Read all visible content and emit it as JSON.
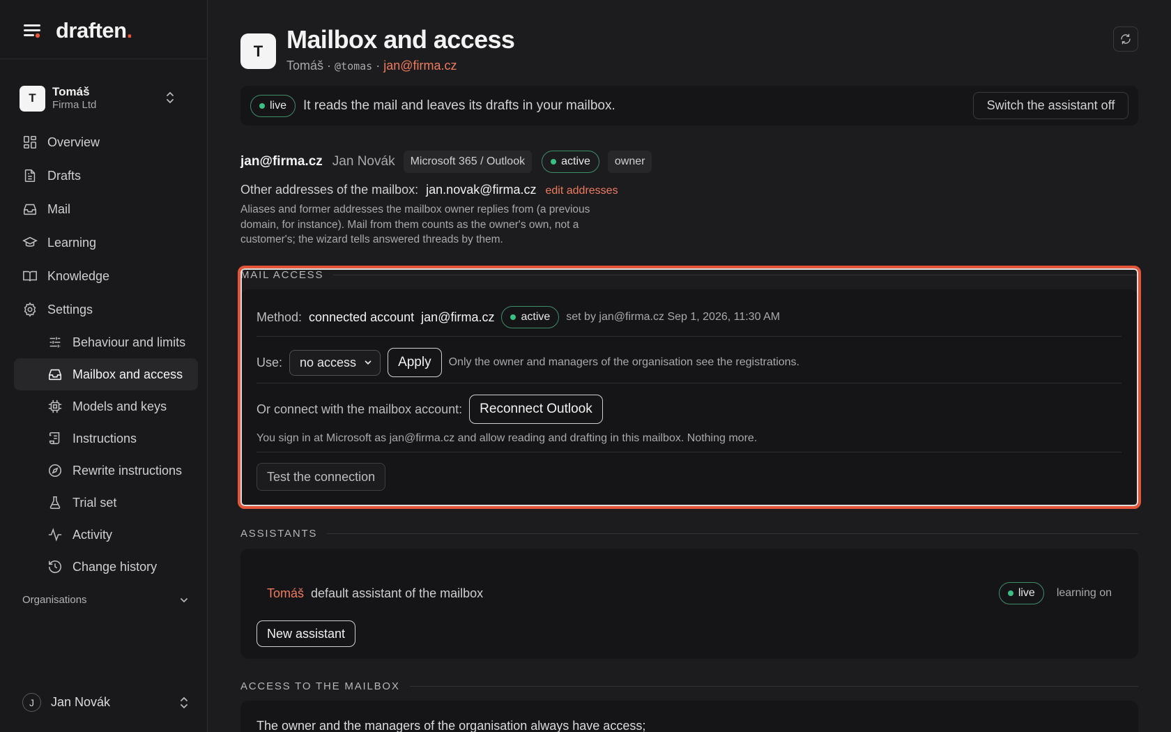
{
  "brand": {
    "logo_text": "draften",
    "logo_dot": "."
  },
  "org": {
    "avatar": "T",
    "name": "Tomáš",
    "company": "Firma Ltd"
  },
  "nav": [
    {
      "label": "Overview",
      "icon": "grid-icon"
    },
    {
      "label": "Drafts",
      "icon": "document-icon"
    },
    {
      "label": "Mail",
      "icon": "inbox-icon"
    },
    {
      "label": "Learning",
      "icon": "graduation-cap-icon"
    },
    {
      "label": "Knowledge",
      "icon": "book-icon"
    },
    {
      "label": "Settings",
      "icon": "gear-icon"
    }
  ],
  "settings_sub": [
    {
      "label": "Behaviour and limits",
      "icon": "sliders-icon"
    },
    {
      "label": "Mailbox and access",
      "icon": "inbox-icon",
      "active": true
    },
    {
      "label": "Models and keys",
      "icon": "cpu-icon"
    },
    {
      "label": "Instructions",
      "icon": "scroll-icon"
    },
    {
      "label": "Rewrite instructions",
      "icon": "compass-icon"
    },
    {
      "label": "Trial set",
      "icon": "flask-icon"
    },
    {
      "label": "Activity",
      "icon": "activity-icon"
    },
    {
      "label": "Change history",
      "icon": "history-icon"
    }
  ],
  "organisations_label": "Organisations",
  "user": {
    "avatar": "J",
    "name": "Jan Novák"
  },
  "header": {
    "avatar": "T",
    "title": "Mailbox and access",
    "sub_name": "Tomáš",
    "sub_sep": " · ",
    "sub_handle": "@tomas",
    "sub_email": "jan@firma.cz"
  },
  "status": {
    "badge": "live",
    "text": "It reads the mail and leaves its drafts in your mailbox.",
    "switch_off": "Switch the assistant off"
  },
  "mailbox": {
    "email": "jan@firma.cz",
    "owner_name": "Jan Novák",
    "provider": "Microsoft 365 / Outlook",
    "state": "active",
    "role": "owner",
    "aliases_label": "Other addresses of the mailbox:",
    "aliases_value": "jan.novak@firma.cz",
    "edit_link": "edit addresses",
    "help": "Aliases and former addresses the mailbox owner replies from (a previous domain, for instance). Mail from them counts as the owner's own, not a customer's; the wizard tells answered threads by them."
  },
  "mail_access": {
    "section": "MAIL ACCESS",
    "method_label": "Method:",
    "method_value": "connected account",
    "method_email": "jan@firma.cz",
    "method_state": "active",
    "method_meta": "set by jan@firma.cz Sep 1, 2026, 11:30 AM",
    "use_label": "Use:",
    "use_value": "no access",
    "apply": "Apply",
    "use_note": "Only the owner and managers of the organisation see the registrations.",
    "connect_label": "Or connect with the mailbox account:",
    "reconnect": "Reconnect Outlook",
    "connect_note": "You sign in at Microsoft as jan@firma.cz and allow reading and drafting in this mailbox. Nothing more.",
    "test": "Test the connection"
  },
  "assistants": {
    "section": "ASSISTANTS",
    "items": [
      {
        "name": "Tomáš",
        "desc": "default assistant of the mailbox",
        "state": "live",
        "learning": "learning on"
      }
    ],
    "new_button": "New assistant"
  },
  "access_mailbox": {
    "section": "ACCESS TO THE MAILBOX",
    "text": "The owner and the managers of the organisation always have access;"
  },
  "colors": {
    "accent": "#ef7b5f",
    "brand_dot": "#e5553a",
    "live_green": "#3bbf84",
    "highlight": "#e5553a"
  }
}
